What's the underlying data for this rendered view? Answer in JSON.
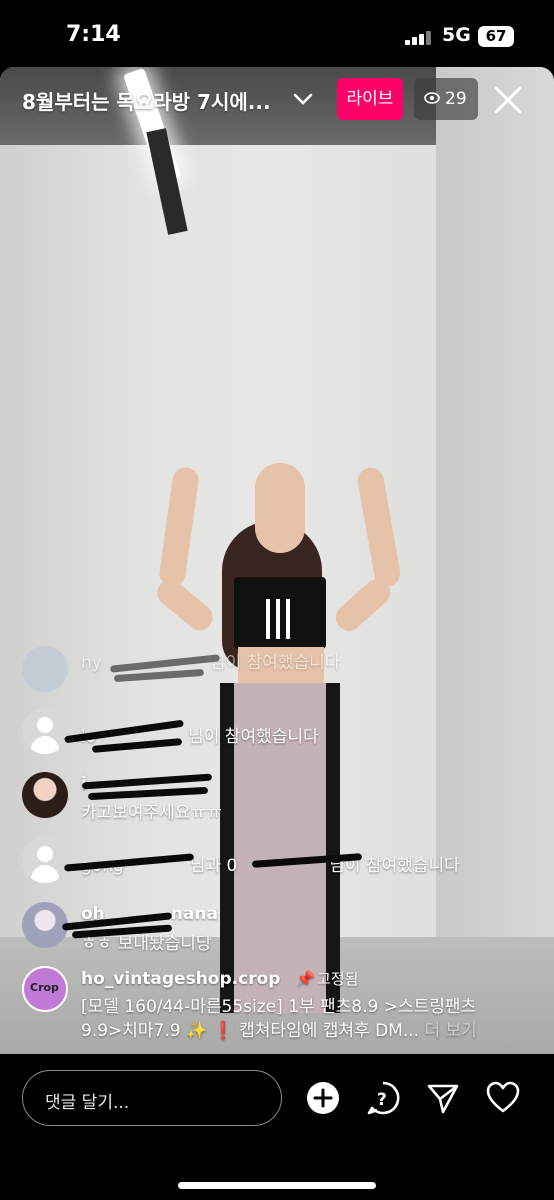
{
  "status": {
    "time": "7:14",
    "network": "5G",
    "battery": "67"
  },
  "header": {
    "title": "8월부터는 목요라방 7시에...",
    "live_label": "라이브",
    "viewer_count": "29"
  },
  "comments": [
    {
      "name": "hy",
      "text_suffix": "님이 참여했습니다"
    },
    {
      "name": "lo",
      "text_suffix": "님이 참여했습니다"
    },
    {
      "name": "i",
      "text": "카고보여주세요ㅠㅠ"
    },
    {
      "name": "gong",
      "text_suffix": "님과 0",
      "text_suffix2": "님이 참여했습니다"
    },
    {
      "name": "oh",
      "name_suffix": "nana",
      "text": "ㅎㅎ 보내놨습니당"
    }
  ],
  "pinned": {
    "avatar_text": "Crop",
    "name": "ho_vintageshop.crop",
    "label": "고정됨",
    "line1": "[모델 160/44-마른55size] 1부 팬츠8.9 >스트링팬츠",
    "line2": "9.9>치마7.9 ✨ ❗ 캡쳐타임에 캡쳐후 DM...",
    "more": "더 보기"
  },
  "footer": {
    "comment_placeholder": "댓글 달기..."
  },
  "icons": [
    "add-icon",
    "question-icon",
    "send-icon",
    "heart-icon",
    "close-icon",
    "eye-icon",
    "chevron-down-icon"
  ],
  "colors": {
    "live": "#ff0069"
  }
}
